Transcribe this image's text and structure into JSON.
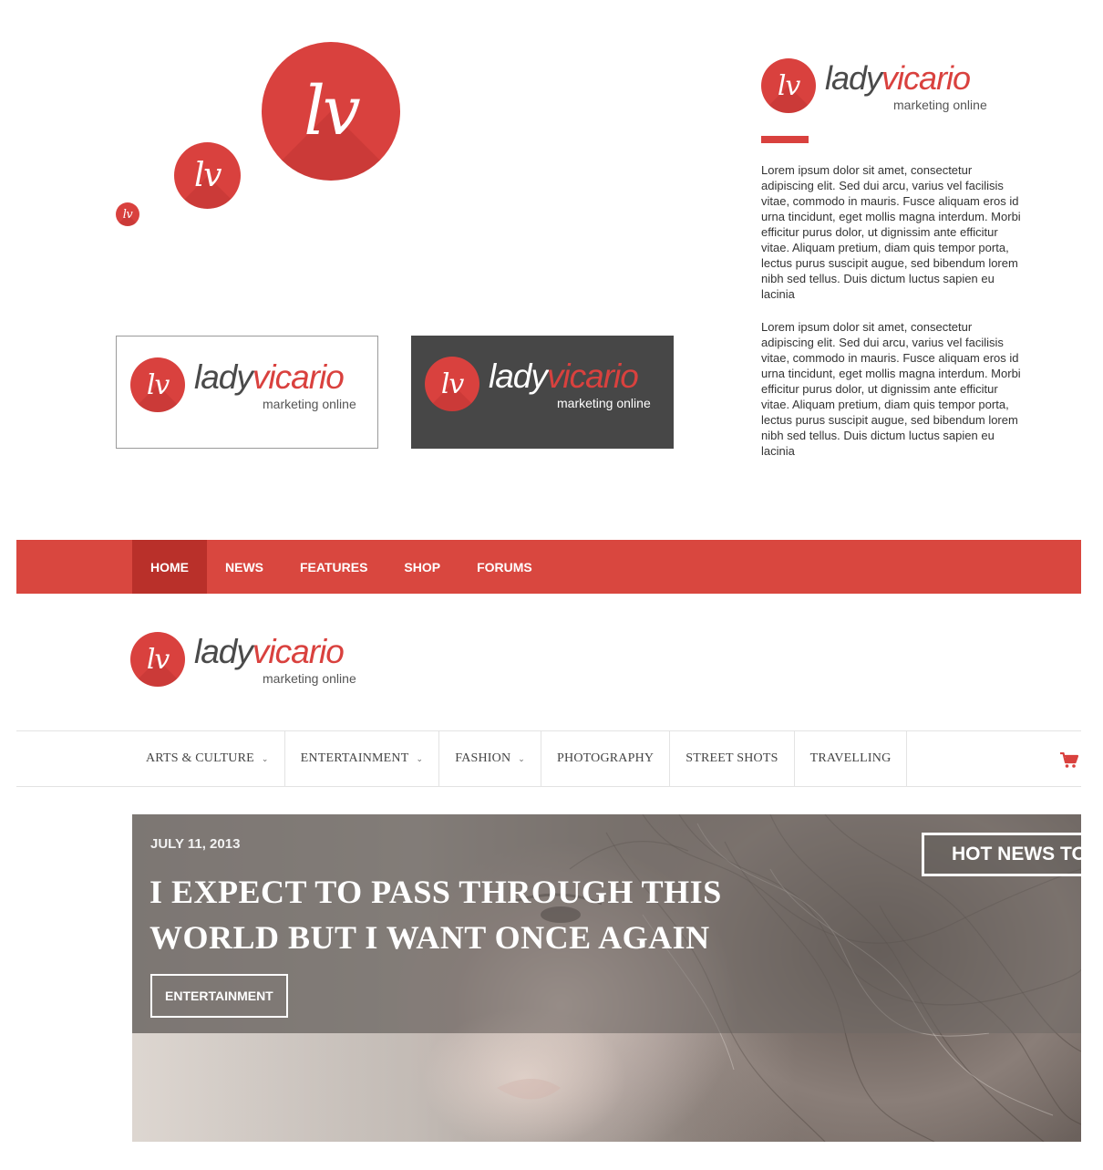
{
  "brand": {
    "monogram": "lv",
    "name_part1": "lady",
    "name_part2": "vicario",
    "tagline": "marketing online",
    "primary_color": "#d9413e",
    "dark_color": "#474747"
  },
  "description": {
    "paragraphs": [
      "Lorem ipsum dolor sit amet, consectetur adipiscing elit. Sed dui arcu, varius vel facilisis vitae, commodo in mauris. Fusce aliquam eros id urna tincidunt, eget mollis magna interdum. Morbi efficitur purus dolor, ut dignissim ante efficitur vitae. Aliquam pretium, diam quis tempor porta, lectus purus suscipit augue, sed bibendum lorem nibh sed tellus. Duis dictum luctus sapien eu lacinia",
      "Lorem ipsum dolor sit amet, consectetur adipiscing elit. Sed dui arcu, varius vel facilisis vitae, commodo in mauris. Fusce aliquam eros id urna tincidunt, eget mollis magna interdum. Morbi efficitur purus dolor, ut dignissim ante efficitur vitae. Aliquam pretium, diam quis tempor porta, lectus purus suscipit augue, sed bibendum lorem nibh sed tellus. Duis dictum luctus sapien eu lacinia"
    ]
  },
  "topnav": {
    "items": [
      {
        "label": "HOME",
        "active": true
      },
      {
        "label": "NEWS"
      },
      {
        "label": "FEATURES"
      },
      {
        "label": "SHOP"
      },
      {
        "label": "FORUMS"
      }
    ]
  },
  "catnav": {
    "items": [
      {
        "label": "ARTS & CULTURE",
        "dropdown": true
      },
      {
        "label": "ENTERTAINMENT",
        "dropdown": true
      },
      {
        "label": "FASHION",
        "dropdown": true
      },
      {
        "label": "PHOTOGRAPHY"
      },
      {
        "label": "STREET SHOTS"
      },
      {
        "label": "TRAVELLING"
      }
    ],
    "cart_icon": "shopping-cart-icon"
  },
  "hero": {
    "date": "JULY 11, 2013",
    "title_line1": "I EXPECT TO PASS THROUGH THIS",
    "title_line2": "WORLD BUT I WANT ONCE AGAIN",
    "category": "ENTERTAINMENT",
    "badge": "HOT NEWS TO"
  }
}
